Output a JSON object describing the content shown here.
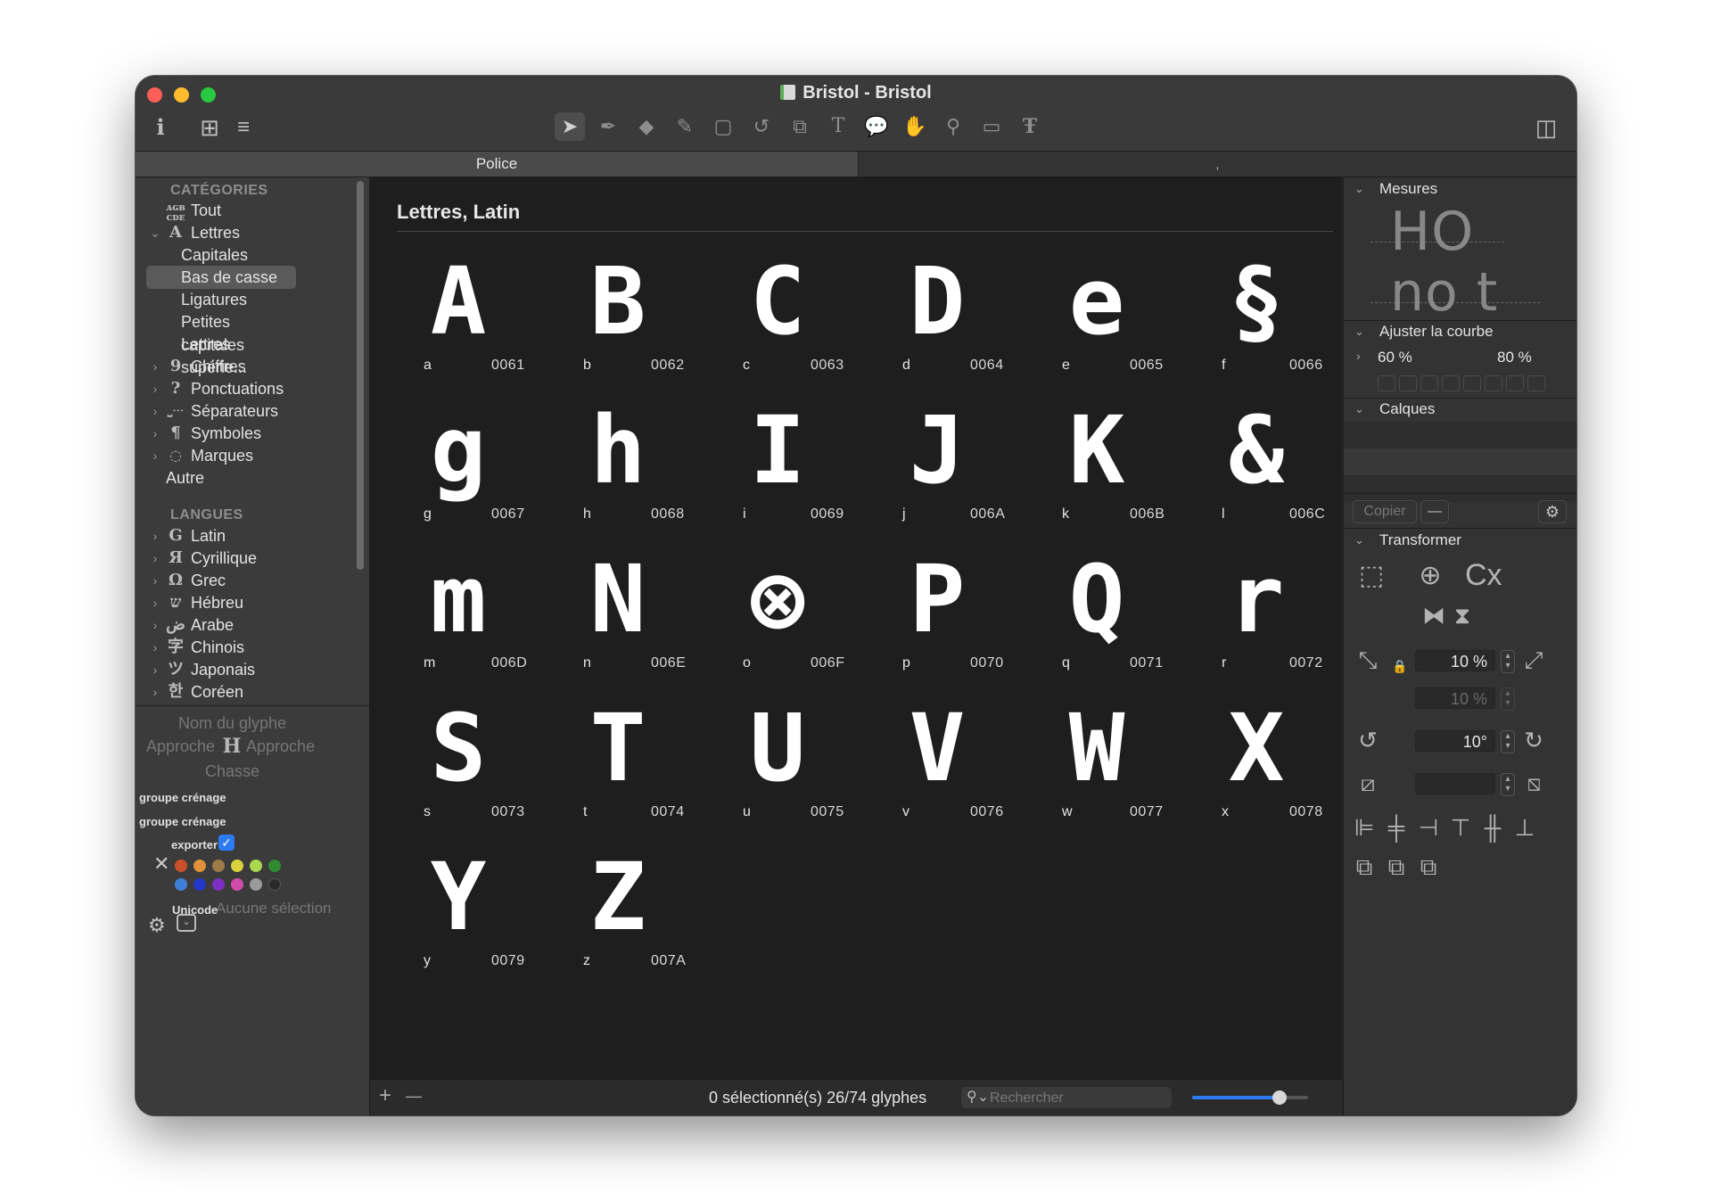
{
  "window": {
    "title": "Bristol - Bristol",
    "colors": {
      "close": "#ff5f57",
      "minimize": "#febc2e",
      "zoom": "#28c840",
      "accent": "#2f7bf4"
    }
  },
  "toolbar": {
    "left_icons": [
      "info-icon",
      "grid-icon",
      "list-icon"
    ],
    "tools": [
      "pointer-tool",
      "pen-tool",
      "eraser-tool",
      "pencil-tool",
      "rectangle-tool",
      "rotate-tool",
      "scale-tool",
      "text-tool",
      "annotation-tool",
      "hand-tool",
      "zoom-tool",
      "measure-tool",
      "type-tool"
    ],
    "right_icon": "sidebar-toggle-icon"
  },
  "tabs": [
    {
      "label": "Police",
      "active": true
    },
    {
      "label": ",",
      "active": false
    }
  ],
  "sidebar": {
    "categories_header": "CATÉGORIES",
    "categories": [
      {
        "label": "Tout",
        "icon": "all-glyphs-icon",
        "expandable": false,
        "level": 0
      },
      {
        "label": "Lettres",
        "icon": "letters-icon",
        "expandable": true,
        "expanded": true,
        "level": 0
      },
      {
        "label": "Capitales",
        "level": 1
      },
      {
        "label": "Bas de casse",
        "level": 1,
        "selected": true
      },
      {
        "label": "Ligatures",
        "level": 1
      },
      {
        "label": "Petites capitales",
        "level": 1
      },
      {
        "label": "Lettres supérie...",
        "level": 1
      },
      {
        "label": "Chiffres",
        "icon": "numbers-icon",
        "expandable": true,
        "level": 0
      },
      {
        "label": "Ponctuations",
        "icon": "punctuation-icon",
        "expandable": true,
        "level": 0
      },
      {
        "label": "Séparateurs",
        "icon": "separators-icon",
        "expandable": true,
        "level": 0
      },
      {
        "label": "Symboles",
        "icon": "symbols-icon",
        "expandable": true,
        "level": 0
      },
      {
        "label": "Marques",
        "icon": "marks-icon",
        "expandable": true,
        "level": 0
      },
      {
        "label": "Autre",
        "level": 0
      }
    ],
    "languages_header": "LANGUES",
    "languages": [
      {
        "label": "Latin",
        "icon": "latin-icon"
      },
      {
        "label": "Cyrillique",
        "icon": "cyrillic-icon"
      },
      {
        "label": "Grec",
        "icon": "greek-icon"
      },
      {
        "label": "Hébreu",
        "icon": "hebrew-icon"
      },
      {
        "label": "Arabe",
        "icon": "arabic-icon"
      },
      {
        "label": "Chinois",
        "icon": "chinese-icon"
      },
      {
        "label": "Japonais",
        "icon": "japanese-icon"
      },
      {
        "label": "Coréen",
        "icon": "korean-icon"
      }
    ],
    "glyph_info": {
      "name_placeholder": "Nom du glyphe",
      "left_sidebearing": "Approche",
      "right_sidebearing": "Approche",
      "width": "Chasse",
      "kerning_group_left": "groupe crénage",
      "kerning_group_right": "groupe crénage",
      "export_label": "exporter",
      "export_checked": true,
      "unicode_label": "Unicode",
      "unicode_value": "Aucune sélection"
    },
    "color_labels": [
      "#c9502a",
      "#e0913a",
      "#9c7a4a",
      "#d8d23c",
      "#a8d84e",
      "#2e8b2e",
      "#3f7fd9",
      "#2438c8",
      "#7d2fc0",
      "#d14ca8",
      "#9a9a9a",
      "#2a2a2a"
    ]
  },
  "main": {
    "title": "Lettres, Latin",
    "glyphs": [
      {
        "name": "a",
        "code": "0061",
        "char": "A"
      },
      {
        "name": "b",
        "code": "0062",
        "char": "B"
      },
      {
        "name": "c",
        "code": "0063",
        "char": "C"
      },
      {
        "name": "d",
        "code": "0064",
        "char": "D"
      },
      {
        "name": "e",
        "code": "0065",
        "char": "e"
      },
      {
        "name": "f",
        "code": "0066",
        "char": "§"
      },
      {
        "name": "g",
        "code": "0067",
        "char": "g"
      },
      {
        "name": "h",
        "code": "0068",
        "char": "h"
      },
      {
        "name": "i",
        "code": "0069",
        "char": "I"
      },
      {
        "name": "j",
        "code": "006A",
        "char": "J"
      },
      {
        "name": "k",
        "code": "006B",
        "char": "K"
      },
      {
        "name": "l",
        "code": "006C",
        "char": "&"
      },
      {
        "name": "m",
        "code": "006D",
        "char": "m"
      },
      {
        "name": "n",
        "code": "006E",
        "char": "N"
      },
      {
        "name": "o",
        "code": "006F",
        "char": "⊗"
      },
      {
        "name": "p",
        "code": "0070",
        "char": "P"
      },
      {
        "name": "q",
        "code": "0071",
        "char": "Q"
      },
      {
        "name": "r",
        "code": "0072",
        "char": "r"
      },
      {
        "name": "s",
        "code": "0073",
        "char": "S"
      },
      {
        "name": "t",
        "code": "0074",
        "char": "T"
      },
      {
        "name": "u",
        "code": "0075",
        "char": "U"
      },
      {
        "name": "v",
        "code": "0076",
        "char": "V"
      },
      {
        "name": "w",
        "code": "0077",
        "char": "W"
      },
      {
        "name": "x",
        "code": "0078",
        "char": "X"
      },
      {
        "name": "y",
        "code": "0079",
        "char": "Y"
      },
      {
        "name": "z",
        "code": "007A",
        "char": "Z"
      }
    ]
  },
  "statusbar": {
    "add": "+",
    "remove": "—",
    "count": "0 sélectionné(s) 26/74 glyphes",
    "search_placeholder": "Rechercher",
    "zoom_level": 0.75
  },
  "inspector": {
    "metrics_header": "Mesures",
    "metrics_preview_top": "HO",
    "metrics_preview_bottom": "no t",
    "curve_header": "Ajuster la courbe",
    "curve_left": "60 %",
    "curve_right": "80 %",
    "layers_header": "Calques",
    "copy_button": "Copier",
    "remove_button": "—",
    "transform_header": "Transformer",
    "transform_label": "Cx",
    "scale_x": "10 %",
    "scale_y": "10 %",
    "rotate": "10°",
    "slant": ""
  }
}
